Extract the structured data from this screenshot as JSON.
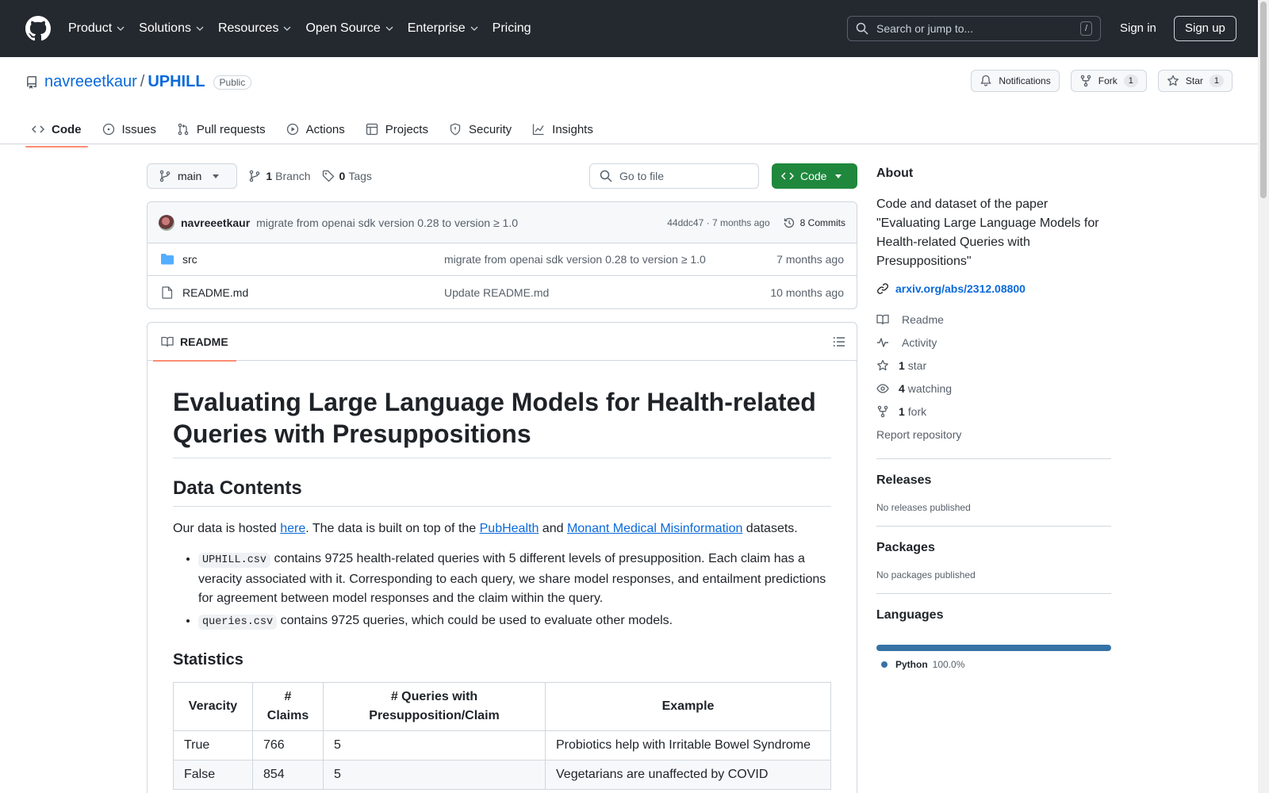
{
  "header": {
    "nav": [
      {
        "label": "Product"
      },
      {
        "label": "Solutions"
      },
      {
        "label": "Resources"
      },
      {
        "label": "Open Source"
      },
      {
        "label": "Enterprise"
      },
      {
        "label": "Pricing"
      }
    ],
    "search_placeholder": "Search or jump to...",
    "search_shortcut": "/",
    "signin": "Sign in",
    "signup": "Sign up"
  },
  "repo": {
    "owner": "navreeetkaur",
    "separator": "/",
    "name": "UPHILL",
    "visibility": "Public",
    "notifications_label": "Notifications",
    "fork_label": "Fork",
    "fork_count": "1",
    "star_label": "Star",
    "star_count": "1"
  },
  "tabs": [
    {
      "label": "Code",
      "icon": "code-icon"
    },
    {
      "label": "Issues",
      "icon": "issue-icon"
    },
    {
      "label": "Pull requests",
      "icon": "pull-request-icon"
    },
    {
      "label": "Actions",
      "icon": "play-icon"
    },
    {
      "label": "Projects",
      "icon": "table-icon"
    },
    {
      "label": "Security",
      "icon": "shield-icon"
    },
    {
      "label": "Insights",
      "icon": "graph-icon"
    }
  ],
  "toolbar": {
    "branch": "main",
    "branch_count": "1",
    "branch_label": "Branch",
    "tag_count": "0",
    "tag_label": "Tags",
    "goto_placeholder": "Go to file",
    "code_button": "Code"
  },
  "commit": {
    "author": "navreeetkaur",
    "message": "migrate from openai sdk version 0.28 to version ≥ 1.0",
    "sha_time": "44ddc47 · 7 months ago",
    "commits_label": "8 Commits"
  },
  "files": [
    {
      "name": "src",
      "type": "folder",
      "message": "migrate from openai sdk version 0.28 to version ≥ 1.0",
      "age": "7 months ago"
    },
    {
      "name": "README.md",
      "type": "file",
      "message": "Update README.md",
      "age": "10 months ago"
    }
  ],
  "readme": {
    "tab_label": "README",
    "title": "Evaluating Large Language Models for Health-related Queries with Presuppositions",
    "section_data": "Data Contents",
    "para": {
      "t1": "Our data is hosted ",
      "l1": "here",
      "t2": ". The data is built on top of the ",
      "l2": "PubHealth",
      "t3": " and ",
      "l3": "Monant Medical Misinformation",
      "t4": " datasets."
    },
    "bullets": [
      {
        "code": "UPHILL.csv",
        "text": " contains 9725 health-related queries with 5 different levels of presupposition. Each claim has a veracity associated with it. Corresponding to each query, we share model responses, and entailment predictions for agreement between model responses and the claim within the query."
      },
      {
        "code": "queries.csv",
        "text": " contains 9725 queries, which could be used to evaluate other models."
      }
    ],
    "section_stats": "Statistics",
    "table": {
      "headers": [
        "Veracity",
        "# Claims",
        "# Queries with Presupposition/Claim",
        "Example"
      ],
      "rows": [
        [
          "True",
          "766",
          "5",
          "Probiotics help with Irritable Bowel Syndrome"
        ],
        [
          "False",
          "854",
          "5",
          "Vegetarians are unaffected by COVID"
        ]
      ]
    }
  },
  "sidebar": {
    "about_title": "About",
    "description": "Code and dataset of the paper \"Evaluating Large Language Models for Health-related Queries with Presuppositions\"",
    "link": "arxiv.org/abs/2312.08800",
    "items": [
      {
        "icon": "book-icon",
        "count": "",
        "label": "Readme"
      },
      {
        "icon": "pulse-icon",
        "count": "",
        "label": "Activity"
      },
      {
        "icon": "star-icon",
        "count": "1",
        "label": "star"
      },
      {
        "icon": "eye-icon",
        "count": "4",
        "label": "watching"
      },
      {
        "icon": "fork-icon",
        "count": "1",
        "label": "fork"
      }
    ],
    "report": "Report repository",
    "releases_title": "Releases",
    "releases_text": "No releases published",
    "packages_title": "Packages",
    "packages_text": "No packages published",
    "languages_title": "Languages",
    "language": {
      "name": "Python",
      "percent": "100.0%",
      "color": "#3572A5"
    }
  },
  "colors": {
    "header_bg": "#24292f",
    "accent": "#0969da",
    "code_button": "#1f883d",
    "tab_underline": "#fd8c73"
  }
}
